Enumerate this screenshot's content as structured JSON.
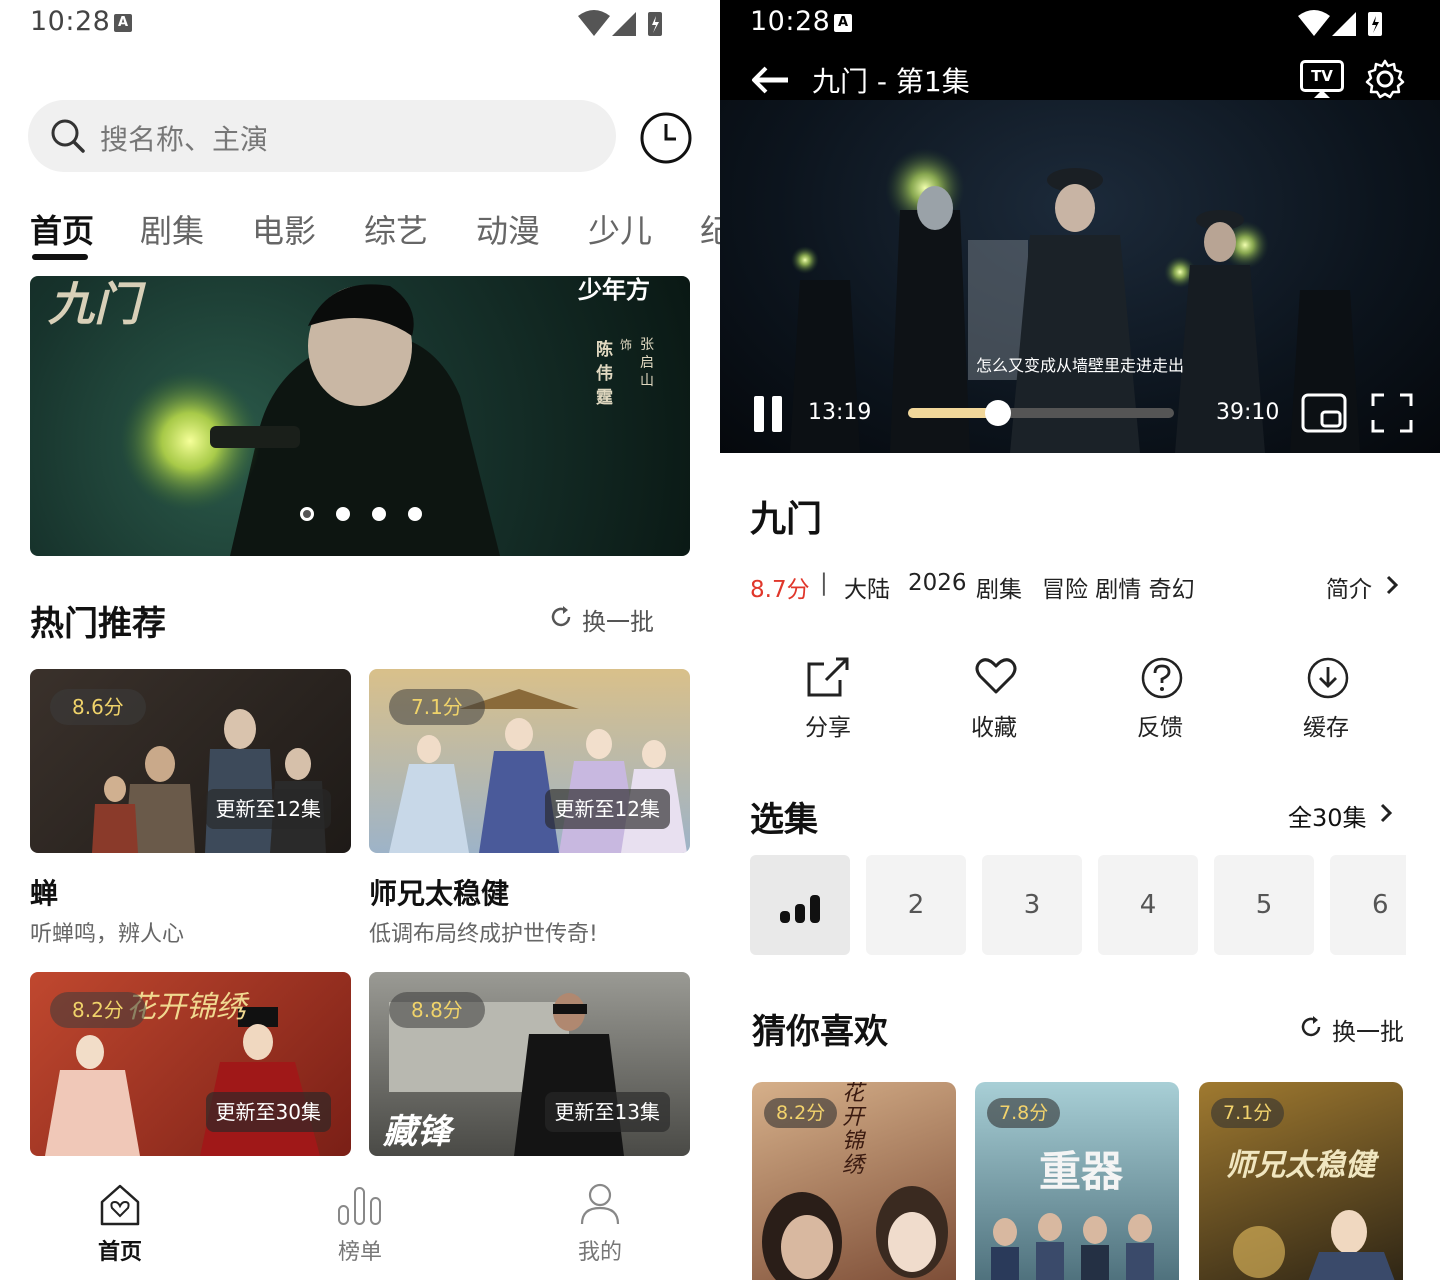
{
  "left": {
    "status_bar": {
      "time": "10:28",
      "notif_icon": "A"
    },
    "search": {
      "placeholder": "搜名称、主演"
    },
    "tabs": [
      "首页",
      "剧集",
      "电影",
      "综艺",
      "动漫",
      "少儿",
      "纪"
    ],
    "banner": {
      "title_art": "九门",
      "brand": "少年方",
      "credit_role": "饰",
      "credit_character": "张启山",
      "credit_actor": "陈伟霆",
      "dots": 4,
      "active_dot": 0
    },
    "hot": {
      "title": "热门推荐",
      "refresh_label": "换一批"
    },
    "cards": [
      {
        "score": "8.6分",
        "update": "更新至12集",
        "title": "蝉",
        "subtitle": "听蝉鸣，辨人心",
        "colors": [
          "#2c2622",
          "#5a4a3c"
        ]
      },
      {
        "score": "7.1分",
        "update": "更新至12集",
        "title": "师兄太稳健",
        "subtitle": "低调布局终成护世传奇!",
        "colors": [
          "#c9b27a",
          "#8aa0b8"
        ]
      },
      {
        "score": "8.2分",
        "update": "更新至30集",
        "title_art": "花开锦绣",
        "colors": [
          "#b3422d",
          "#7a1f16"
        ]
      },
      {
        "score": "8.8分",
        "update": "更新至13集",
        "title_art": "藏锋",
        "colors": [
          "#8c8c86",
          "#3a3a38"
        ]
      }
    ],
    "bottom_nav": [
      {
        "label": "首页",
        "icon": "home-heart-icon",
        "active": true
      },
      {
        "label": "榜单",
        "icon": "chart-bars-icon",
        "active": false
      },
      {
        "label": "我的",
        "icon": "person-icon",
        "active": false
      }
    ]
  },
  "right": {
    "status_bar": {
      "time": "10:28",
      "notif_icon": "A"
    },
    "player": {
      "title": "九门 - 第1集",
      "tv_label": "TV",
      "subtitle": "怎么又变成从墙壁里走进走出",
      "current_time": "13:19",
      "total_time": "39:10",
      "progress": 0.34
    },
    "show": {
      "title": "九门",
      "score": "8.7分",
      "separator": "|",
      "region": "大陆",
      "year": "2026",
      "type": "剧集",
      "genres": "冒险 剧情 奇幻",
      "intro_label": "简介"
    },
    "actions": [
      {
        "label": "分享",
        "icon": "share-icon"
      },
      {
        "label": "收藏",
        "icon": "heart-icon"
      },
      {
        "label": "反馈",
        "icon": "help-circle-icon"
      },
      {
        "label": "缓存",
        "icon": "download-icon"
      }
    ],
    "episodes": {
      "title": "选集",
      "all_label": "全30集",
      "items": [
        "1",
        "2",
        "3",
        "4",
        "5",
        "6"
      ],
      "playing": "1"
    },
    "recommend": {
      "title": "猜你喜欢",
      "refresh_label": "换一批",
      "items": [
        {
          "score": "8.2分",
          "title_art": "花开锦绣",
          "colors": [
            "#c9a07a",
            "#6a3a2a"
          ]
        },
        {
          "score": "7.8分",
          "title_art": "重器",
          "colors": [
            "#9cc2c8",
            "#3a5a66"
          ]
        },
        {
          "score": "7.1分",
          "title_art": "师兄太稳健",
          "colors": [
            "#8a6a2a",
            "#2a2416"
          ]
        }
      ]
    }
  },
  "colors": {
    "accent_red": "#e0372b",
    "score_gold": "#f0d36a",
    "progress_fill": "#f1d79a"
  }
}
